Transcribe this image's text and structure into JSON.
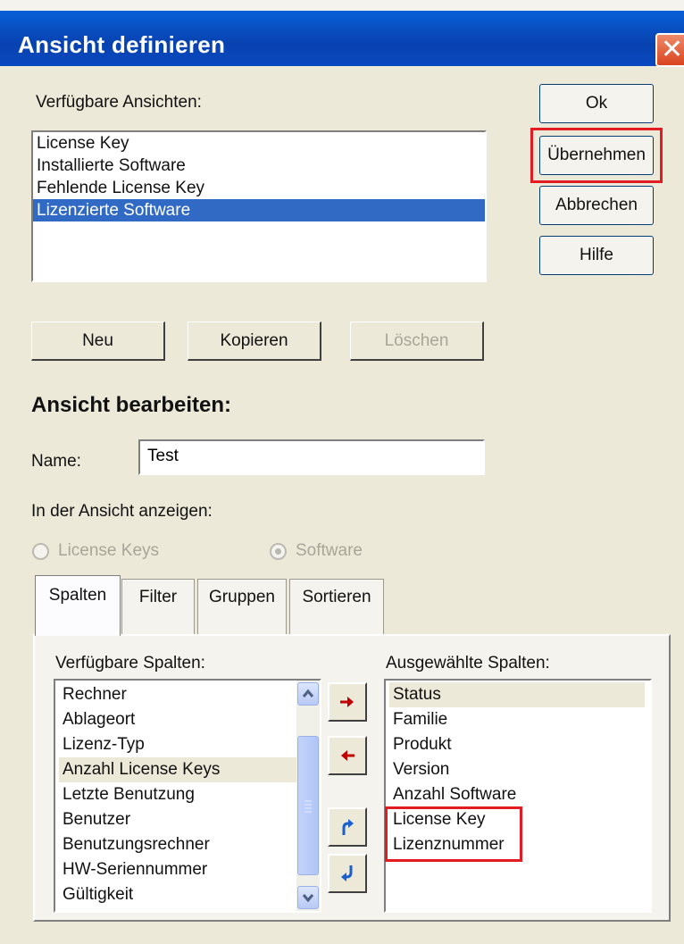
{
  "window": {
    "title": "Ansicht definieren",
    "close_glyph": "✕"
  },
  "views": {
    "label": "Verfügbare Ansichten:",
    "items": [
      "License Key",
      "Installierte Software",
      "Fehlende License Key",
      "Lizenzierte Software"
    ],
    "selected_index": 3
  },
  "side_buttons": {
    "ok": "Ok",
    "apply": "Übernehmen",
    "cancel": "Abbrechen",
    "help": "Hilfe"
  },
  "view_buttons": {
    "new": "Neu",
    "copy": "Kopieren",
    "delete": "Löschen"
  },
  "edit": {
    "heading": "Ansicht bearbeiten:",
    "name_label": "Name:",
    "name_value": "Test",
    "show_label": "In der Ansicht anzeigen:",
    "radio_license_keys": "License Keys",
    "radio_software": "Software",
    "radio_selected": "Software"
  },
  "tabs": {
    "items": [
      "Spalten",
      "Filter",
      "Gruppen",
      "Sortieren"
    ],
    "active": "Spalten"
  },
  "columns": {
    "available_label": "Verfügbare Spalten:",
    "available": [
      "Rechner",
      "Ablageort",
      "Lizenz-Typ",
      "Anzahl License Keys",
      "Letzte Benutzung",
      "Benutzer",
      "Benutzungsrechner",
      "HW-Seriennummer",
      "Gültigkeit"
    ],
    "available_highlight_index": 3,
    "selected_label": "Ausgewählte Spalten:",
    "selected": [
      "Status",
      "Familie",
      "Produkt",
      "Version",
      "Anzahl Software",
      "License Key",
      "Lizenznummer"
    ],
    "selected_highlight_index": 0
  },
  "icons": {
    "add": "arrow-right-icon",
    "remove": "arrow-left-icon",
    "move_up": "move-up-icon",
    "move_down": "move-down-icon",
    "scroll_up": "chevron-up-icon",
    "scroll_down": "chevron-down-icon"
  },
  "colors": {
    "title_bar": "#0842b0",
    "selection": "#316ac5",
    "highlight_box": "#e31b23",
    "arrow_red": "#c00000",
    "arrow_blue": "#1a5fcf"
  }
}
